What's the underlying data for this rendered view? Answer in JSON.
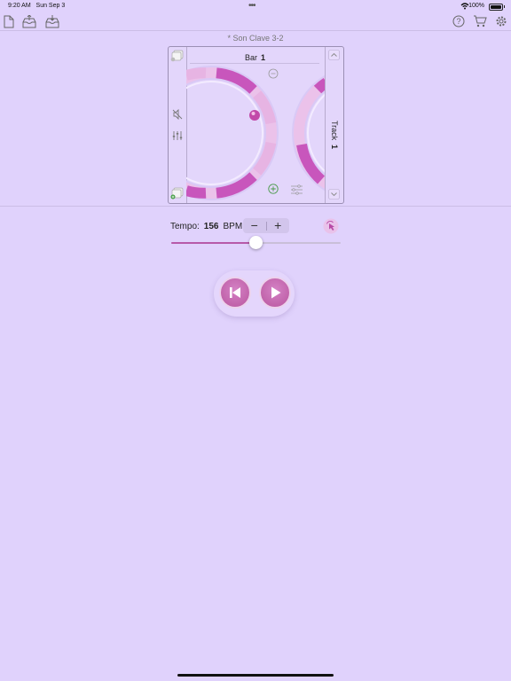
{
  "status_bar": {
    "time": "9:20 AM",
    "date": "Sun Sep 3",
    "battery": "100%"
  },
  "toolbar": {
    "left_icons": [
      "new-document-icon",
      "import-icon",
      "export-icon"
    ],
    "right_icons": [
      "help-icon",
      "cart-icon",
      "settings-icon"
    ]
  },
  "document": {
    "title": "* Son Clave 3-2"
  },
  "editor": {
    "bar_label": "Bar",
    "bar_number": "1",
    "track_label": "Track",
    "track_number": "1"
  },
  "tempo": {
    "label": "Tempo:",
    "value": "156",
    "unit": "BPM",
    "decrement": "−",
    "increment": "+",
    "slider_fraction": 0.5
  },
  "colors": {
    "background": "#e0d2fc",
    "accent": "#c057b4",
    "accent_light": "#e9bfe6",
    "slider_fill": "#b75aa9"
  }
}
